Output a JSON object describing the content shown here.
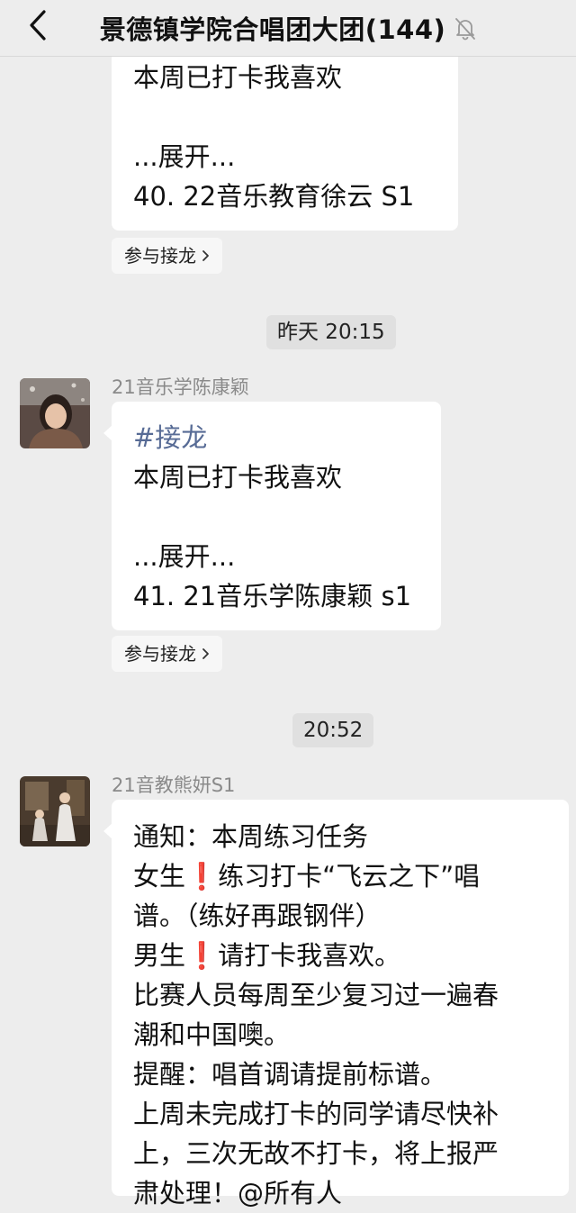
{
  "header": {
    "back_icon": "chevron-left-icon",
    "title": "景德镇学院合唱团大团(144)",
    "mute_icon": "bell-off-icon"
  },
  "messages": {
    "m1": {
      "lines": [
        "本周已打卡我喜欢",
        "",
        "...展开...",
        "40. 22音乐教育徐云 S1"
      ],
      "action": "参与接龙"
    },
    "time1": "昨天 20:15",
    "m2": {
      "sender": "21音乐学陈康颖",
      "hashtag": "#接龙",
      "lines": [
        "本周已打卡我喜欢",
        "",
        "...展开...",
        "41. 21音乐学陈康颖 s1"
      ],
      "action": "参与接龙"
    },
    "time2": "20:52",
    "m3": {
      "sender": "21音教熊妍S1",
      "l1": "通知：本周练习任务",
      "l2a": "女生",
      "l2warn": "❗",
      "l2b": "练习打卡“飞云之下”唱",
      "l3": "谱。（练好再跟钢伴）",
      "l4a": "男生",
      "l4warn": "❗",
      "l4b": "请打卡我喜欢。",
      "l5": "比赛人员每周至少复习过一遍春",
      "l6": "潮和中国噢。",
      "l7": "提醒：唱首调请提前标谱。",
      "l8": "上周未完成打卡的同学请尽快补",
      "l9": "上，三次无故不打卡，将上报严",
      "l10": "肃处理！@所有人"
    }
  },
  "colors": {
    "background": "#ededed",
    "bubble": "#ffffff",
    "hashtag": "#576b95",
    "warn": "#e02020"
  }
}
